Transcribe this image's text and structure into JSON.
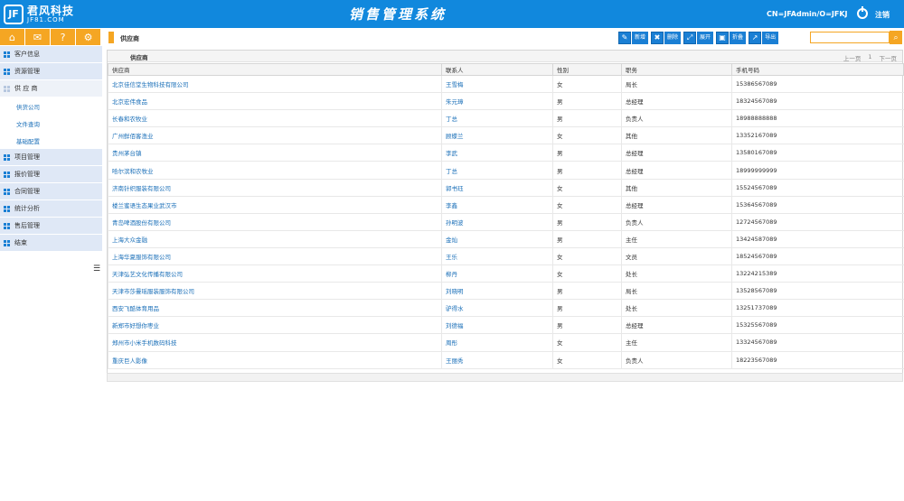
{
  "header": {
    "logo_mark": "JF",
    "logo_cn": "君风科技",
    "logo_en": "JF81.COM",
    "app_title": "销售管理系统",
    "user": "CN=JFAdmin/O=JFKJ",
    "logout": "注销"
  },
  "iconbar": [
    {
      "icon": "home-icon",
      "glyph": "⌂"
    },
    {
      "icon": "mail-icon",
      "glyph": "✉"
    },
    {
      "icon": "help-icon",
      "glyph": "?"
    },
    {
      "icon": "gear-icon",
      "glyph": "⚙"
    }
  ],
  "sidebar": {
    "items": [
      {
        "label": "客户信息"
      },
      {
        "label": "资源管理"
      },
      {
        "label": "供 应 商"
      },
      {
        "label": "项目管理"
      },
      {
        "label": "报价管理"
      },
      {
        "label": "合同管理"
      },
      {
        "label": "统计分析"
      },
      {
        "label": "售后管理"
      },
      {
        "label": "结束"
      }
    ],
    "sub_items": [
      {
        "label": "供货公司"
      },
      {
        "label": "文件查询"
      },
      {
        "label": "基础配置"
      }
    ]
  },
  "main": {
    "breadcrumb": "供应商",
    "panel_title": "供应商",
    "toolbar": [
      {
        "label": "新增",
        "glyph": "✎"
      },
      {
        "label": "删除",
        "glyph": "✖"
      },
      {
        "label": "展开",
        "glyph": "⤢"
      },
      {
        "label": "折叠",
        "glyph": "▣"
      },
      {
        "label": "导出",
        "glyph": "↗"
      }
    ],
    "search_placeholder": "",
    "pager": {
      "prev": "上一页",
      "page": "1",
      "next": "下一页"
    },
    "columns": [
      "供应商",
      "联系人",
      "性别",
      "职务",
      "手机号码"
    ],
    "rows": [
      [
        "北京佳信堂生物科技有限公司",
        "王雪梅",
        "女",
        "局长",
        "15386567089"
      ],
      [
        "北京宏伟食品",
        "朱元璋",
        "男",
        "总经理",
        "18324567089"
      ],
      [
        "长春和农牧业",
        "丁总",
        "男",
        "负责人",
        "18988888888"
      ],
      [
        "广州鲜佰客渔业",
        "顾蝶兰",
        "女",
        "其他",
        "13352167089"
      ],
      [
        "贵州茅台镇",
        "李武",
        "男",
        "总经理",
        "13580167089"
      ],
      [
        "哈尔滨和农牧业",
        "丁总",
        "男",
        "总经理",
        "18999999999"
      ],
      [
        "济南针织服装有限公司",
        "郭书珏",
        "女",
        "其他",
        "15524567089"
      ],
      [
        "楼兰蜜语生态果业武汉市",
        "李鑫",
        "女",
        "总经理",
        "15364567089"
      ],
      [
        "青岛啤酒股份有限公司",
        "孙明波",
        "男",
        "负责人",
        "12724567089"
      ],
      [
        "上海大众金融",
        "金灿",
        "男",
        "主任",
        "13424587089"
      ],
      [
        "上海华夏服饰有限公司",
        "王乐",
        "女",
        "文员",
        "18524567089"
      ],
      [
        "天津弘艺文化传播有限公司",
        "柳丹",
        "女",
        "处长",
        "13224215389"
      ],
      [
        "天津市莎曼瑶服装服饰有限公司",
        "刘晓明",
        "男",
        "局长",
        "13528567089"
      ],
      [
        "西安飞酷体育用品",
        "驴得水",
        "男",
        "处长",
        "13251737089"
      ],
      [
        "新郑市好想你枣业",
        "刘德福",
        "男",
        "总经理",
        "15325567089"
      ],
      [
        "郑州市小米手机数码科技",
        "周彤",
        "女",
        "主任",
        "13324567089"
      ],
      [
        "重庆巨人影像",
        "王丽秀",
        "女",
        "负责人",
        "18223567089"
      ]
    ]
  }
}
